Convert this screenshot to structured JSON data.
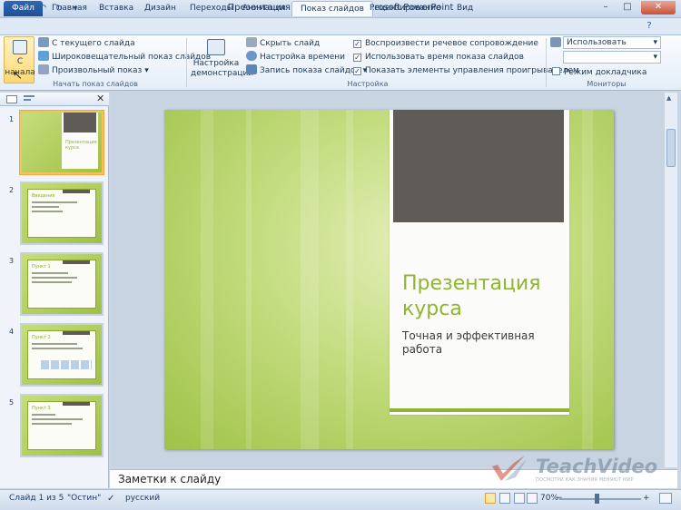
{
  "window": {
    "title": "Презентация фирмы.pptx - Microsoft PowerPoint",
    "app_icon": "P"
  },
  "tabs": [
    "Файл",
    "Главная",
    "Вставка",
    "Дизайн",
    "Переходы",
    "Анимация",
    "Показ слайдов",
    "Рецензирование",
    "Вид"
  ],
  "ribbon": {
    "start_group": {
      "big_button_line1": "С",
      "big_button_line2": "начала",
      "from_current": "С текущего слайда",
      "broadcast": "Широковещательный показ слайдов",
      "custom_show": "Произвольный показ",
      "label": "Начать показ слайдов"
    },
    "setup_group": {
      "setup_button_line1": "Настройка",
      "setup_button_line2": "демонстрации",
      "hide_slide": "Скрыть слайд",
      "rehearse": "Настройка времени",
      "record": "Запись показа слайдов",
      "play_narrations": "Воспроизвести речевое сопровождение",
      "use_timings": "Использовать время показа слайдов",
      "show_media_controls": "Показать элементы управления проигрывателем",
      "label": "Настройка"
    },
    "monitors_group": {
      "resolution": "Использовать текуще...",
      "show_on": "",
      "presenter_view": "Режим докладчика",
      "label": "Мониторы"
    }
  },
  "thumbnails": [
    {
      "num": "1",
      "title": "Презентация курса",
      "selected": true
    },
    {
      "num": "2",
      "title": "Введение",
      "selected": false
    },
    {
      "num": "3",
      "title": "Пункт 1",
      "selected": false
    },
    {
      "num": "4",
      "title": "Пункт 2",
      "selected": false
    },
    {
      "num": "5",
      "title": "Пункт 3",
      "selected": false
    }
  ],
  "slide": {
    "title": "Презентация курса",
    "subtitle": "Точная и эффективная работа"
  },
  "notes_placeholder": "Заметки к слайду",
  "watermark": {
    "brand": "TeachVideo",
    "tagline": "ПОСМОТРИ КАК ЗНАНИЯ МЕНЯЮТ МИР"
  },
  "status": {
    "slide_info": "Слайд 1 из 5",
    "theme": "\"Остин\"",
    "language": "русский",
    "zoom": "70%"
  },
  "colors": {
    "accent_green": "#8fb532",
    "dark_block": "#5f5b57",
    "ribbon_blue": "#2f68b5"
  }
}
